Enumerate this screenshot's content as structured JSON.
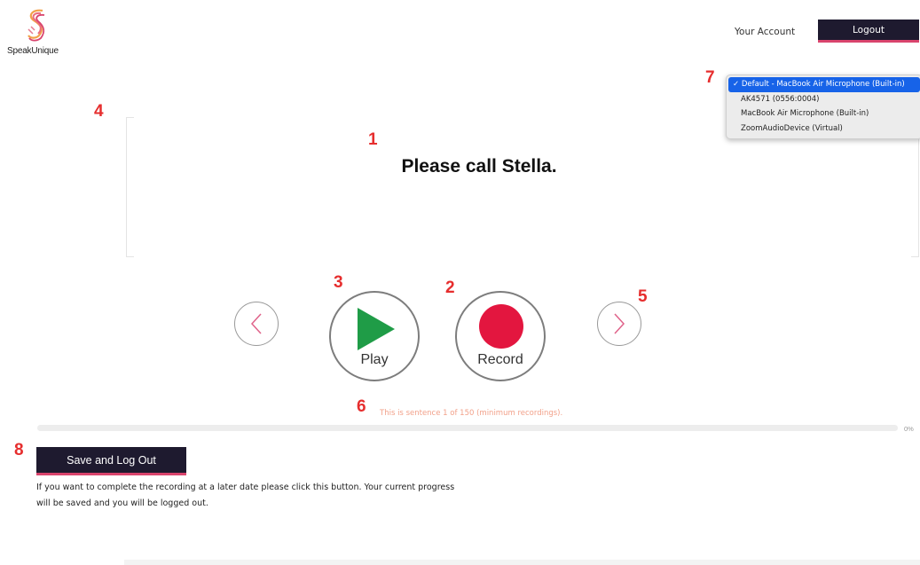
{
  "brand": {
    "name": "SpeakUnique"
  },
  "header": {
    "account_label": "Your Account",
    "logout_label": "Logout"
  },
  "sentence": {
    "text": "Please call Stella."
  },
  "controls": {
    "play_label": "Play",
    "record_label": "Record",
    "play_color": "#1f9c47",
    "record_color": "#e3163f"
  },
  "progress": {
    "status_text": "This is sentence 1 of 150 (minimum recordings).",
    "percent_label": "0%",
    "percent": 0
  },
  "save": {
    "button_label": "Save and Log Out",
    "help_text": "If you want to complete the recording at a later date please click this button. Your current progress will be saved and you will be logged out."
  },
  "microphone_menu": {
    "options": [
      "✓ Default - MacBook Air Microphone (Built-in)",
      "AK4571 (0556:0004)",
      "MacBook Air Microphone (Built-in)",
      "ZoomAudioDevice (Virtual)"
    ]
  },
  "annotations": [
    "1",
    "2",
    "3",
    "4",
    "5",
    "6",
    "7",
    "8"
  ],
  "colors": {
    "accent": "#d9446d",
    "dark": "#1e1a2f",
    "progress": "#f2a18a",
    "annotation": "#e62e2e"
  }
}
